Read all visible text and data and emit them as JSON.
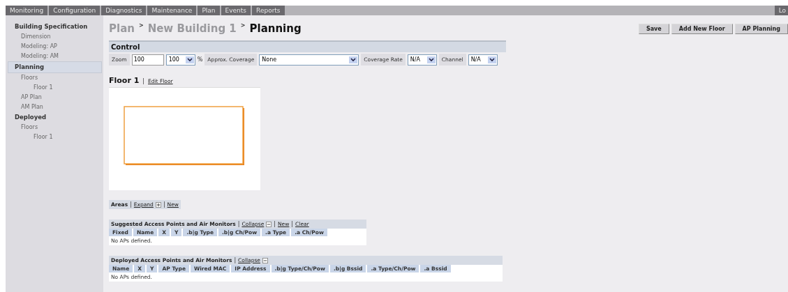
{
  "nav_tabs": [
    {
      "label": "Monitoring",
      "selected": false
    },
    {
      "label": "Configuration",
      "selected": false
    },
    {
      "label": "Diagnostics",
      "selected": false
    },
    {
      "label": "Maintenance",
      "selected": false
    },
    {
      "label": "Plan",
      "selected": false
    },
    {
      "label": "Events",
      "selected": false
    },
    {
      "label": "Reports",
      "selected": false
    }
  ],
  "nav_right": "Lo",
  "sidebar": [
    {
      "label": "Building Specification",
      "selected": false,
      "children": [
        {
          "label": "Dimension",
          "selected": false
        },
        {
          "label": "Modeling: AP",
          "selected": false
        },
        {
          "label": "Modeling: AM",
          "selected": false
        }
      ]
    },
    {
      "label": "Planning",
      "selected": true,
      "children": [
        {
          "label": "Floors",
          "selected": false,
          "children": [
            {
              "label": "Floor 1",
              "selected": false
            }
          ]
        },
        {
          "label": "AP Plan",
          "selected": false
        },
        {
          "label": "AM Plan",
          "selected": false
        }
      ]
    },
    {
      "label": "Deployed",
      "selected": false,
      "children": [
        {
          "label": "Floors",
          "selected": false,
          "children": [
            {
              "label": "Floor 1",
              "selected": false
            }
          ]
        }
      ]
    }
  ],
  "breadcrumb": [
    {
      "kind": "crumb",
      "text": "Plan"
    },
    {
      "kind": "sep",
      "text": ">"
    },
    {
      "kind": "crumb",
      "text": "New Building 1"
    },
    {
      "kind": "sep",
      "text": ">"
    },
    {
      "kind": "current",
      "text": "Planning"
    }
  ],
  "buttons": [
    "Save",
    "Add New Floor",
    "AP Planning"
  ],
  "control": {
    "title": "Control",
    "items": [
      {
        "kind": "label",
        "text": "Zoom"
      },
      {
        "kind": "input",
        "value": "100"
      },
      {
        "kind": "select",
        "value": "100"
      },
      {
        "kind": "unit",
        "text": "%"
      },
      {
        "kind": "label",
        "text": "Approx. Coverage"
      },
      {
        "kind": "wideselect",
        "value": "None"
      },
      {
        "kind": "label",
        "text": "Coverage Rate"
      },
      {
        "kind": "select",
        "value": "N/A"
      },
      {
        "kind": "label",
        "text": "Channel"
      },
      {
        "kind": "select",
        "value": "N/A"
      }
    ]
  },
  "floor": {
    "title": "Floor 1",
    "separator": "|",
    "link": "Edit Floor"
  },
  "areas": [
    {
      "kind": "title",
      "text": "Areas"
    },
    {
      "kind": "sep",
      "text": "|"
    },
    {
      "kind": "expandlink",
      "text": "Expand"
    },
    {
      "kind": "sep",
      "text": "|"
    },
    {
      "kind": "link",
      "text": "New"
    }
  ],
  "tables": [
    {
      "header": [
        {
          "kind": "title",
          "text": "Suggested Access Points and Air Monitors"
        },
        {
          "kind": "sep",
          "text": "|"
        },
        {
          "kind": "collapselink",
          "text": "Collapse"
        },
        {
          "kind": "sep",
          "text": "|"
        },
        {
          "kind": "link",
          "text": "New"
        },
        {
          "kind": "sep",
          "text": "|"
        },
        {
          "kind": "link",
          "text": "Clear"
        }
      ],
      "columns": [
        "Fixed",
        "Name",
        "X",
        "Y",
        ".b|g Type",
        ".b|g Ch/Pow",
        ".a Type",
        ".a Ch/Pow"
      ],
      "empty": "No APs defined."
    },
    {
      "header": [
        {
          "kind": "title",
          "text": "Deployed Access Points and Air Monitors"
        },
        {
          "kind": "sep",
          "text": "|"
        },
        {
          "kind": "collapselink",
          "text": "Collapse"
        }
      ],
      "columns": [
        "Name",
        "X",
        "Y",
        "AP Type",
        "Wired MAC",
        "IP Address",
        ".b|g Type/Ch/Pow",
        ".b|g Bssid",
        ".a Type/Ch/Pow",
        ".a Bssid"
      ],
      "empty": "No APs defined."
    }
  ]
}
